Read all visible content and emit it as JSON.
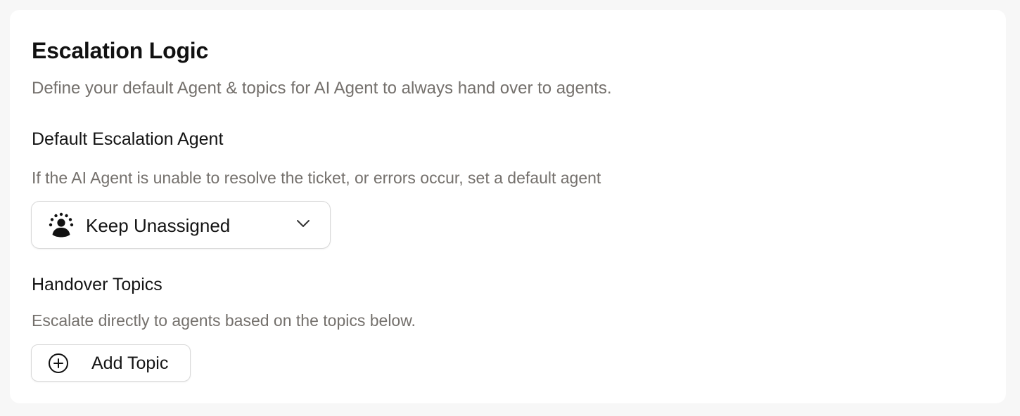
{
  "page": {
    "title": "Escalation Logic",
    "subtitle": "Define your default Agent & topics for AI Agent to always hand over to agents."
  },
  "default_agent": {
    "heading": "Default Escalation Agent",
    "description": "If the AI Agent is unable to resolve the ticket, or errors occur, set a default agent",
    "select": {
      "icon": "unassigned-user-icon",
      "selected": "Keep Unassigned",
      "chevron_icon": "chevron-down-icon"
    }
  },
  "handover_topics": {
    "heading": "Handover Topics",
    "description": "Escalate directly to agents based on the topics below.",
    "add_button": {
      "icon": "plus-circle-icon",
      "label": "Add Topic"
    }
  }
}
